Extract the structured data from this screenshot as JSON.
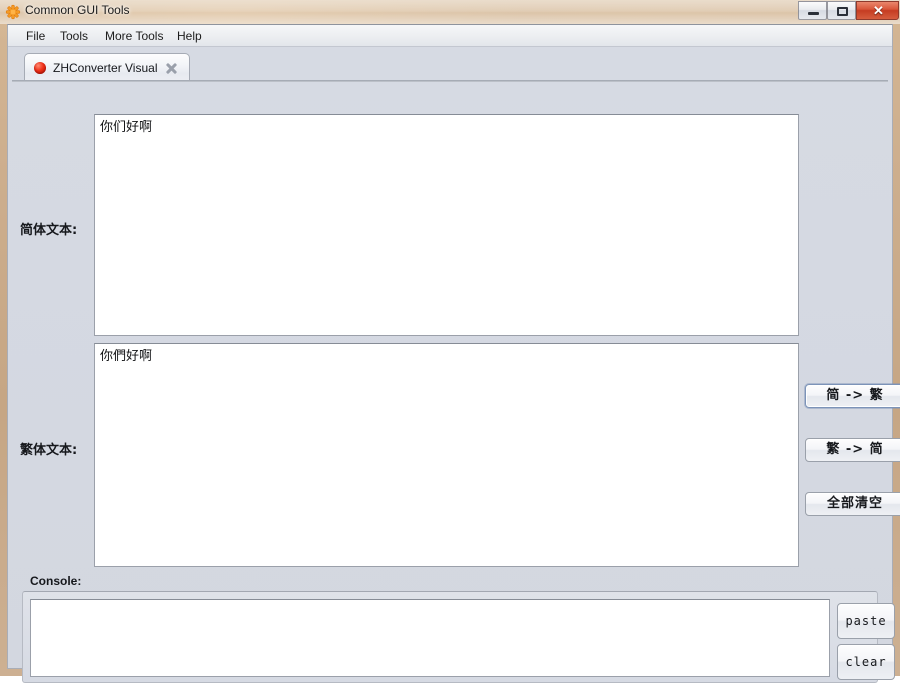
{
  "window": {
    "title": "Common GUI Tools",
    "app_icon": "asterisk-icon",
    "controls": {
      "minimize": "minimize-icon",
      "maximize": "maximize-icon",
      "close_label": "✕"
    }
  },
  "menubar": {
    "items": [
      {
        "label": "File"
      },
      {
        "label": "Tools"
      },
      {
        "label": "More Tools"
      },
      {
        "label": "Help"
      }
    ]
  },
  "tabs": [
    {
      "label": "ZHConverter Visual",
      "icon": "red-sphere-icon",
      "close_icon": "close-icon",
      "active": true
    }
  ],
  "main": {
    "simplified": {
      "label": "简体文本:",
      "value": "你们好啊",
      "placeholder": ""
    },
    "traditional": {
      "label": "繁体文本:",
      "value": "你們好啊",
      "placeholder": ""
    },
    "buttons": [
      {
        "id": "s2t",
        "label": "简 -> 繁",
        "focused": true
      },
      {
        "id": "t2s",
        "label": "繁 -> 简",
        "focused": false
      },
      {
        "id": "clear_all",
        "label": "全部清空",
        "focused": false
      }
    ]
  },
  "console": {
    "label": "Console:",
    "value": "",
    "placeholder": "",
    "buttons": [
      {
        "id": "paste",
        "label": "paste"
      },
      {
        "id": "clear",
        "label": "clear"
      }
    ]
  },
  "colors": {
    "desktop": "#c9ac8c",
    "panel": "#d3d7e0",
    "field": "#ffffff",
    "close_button": "#c53c22",
    "tab_dot": "#f03018",
    "focus_outline": "#7c93b8"
  }
}
